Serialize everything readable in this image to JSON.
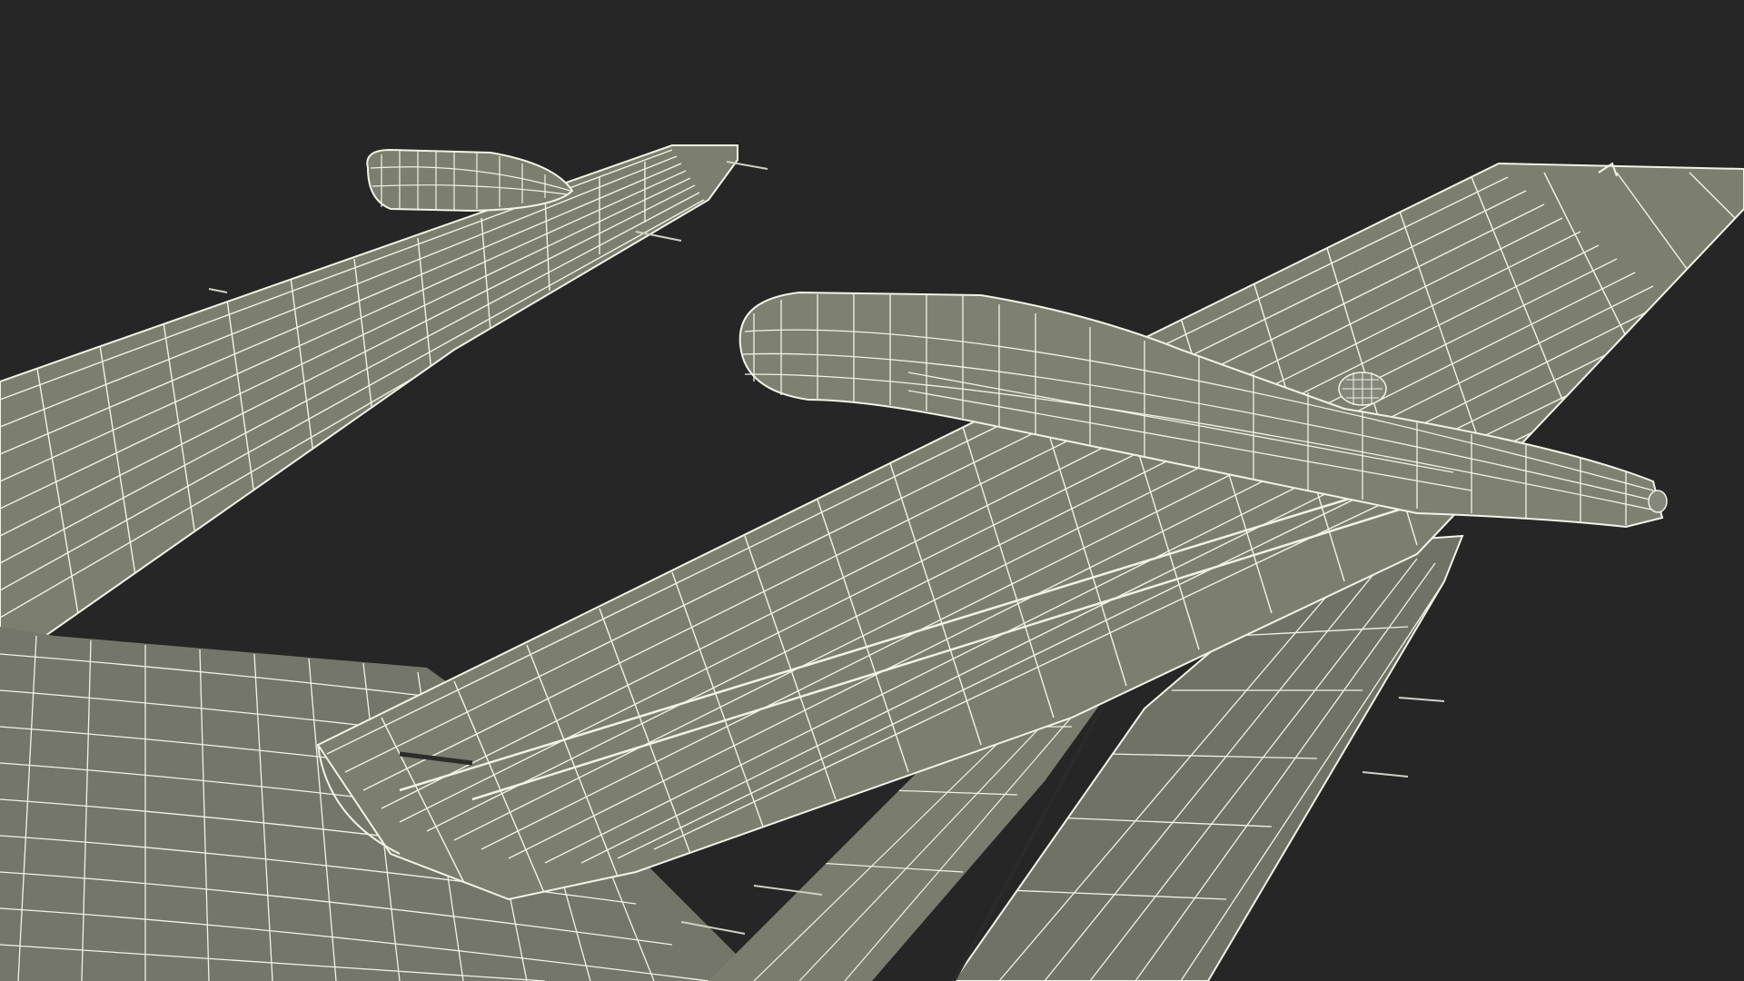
{
  "scene": {
    "subject": "aircraft-wireframe",
    "colors": {
      "background": "#262626",
      "surface": "#7c7e70",
      "surface_shade": "#6d6f62",
      "surface_light": "#8a8c7e",
      "wire": "#f2f3e6",
      "wire_dim": "#d9dbcc",
      "antenna": "#cfd1c3"
    },
    "parts": [
      "left-wing",
      "left-engine-nacelle",
      "left-fuselage-boom",
      "right-wing",
      "right-engine-nacelle",
      "tail-boom",
      "center-fuselage",
      "antenna"
    ]
  }
}
